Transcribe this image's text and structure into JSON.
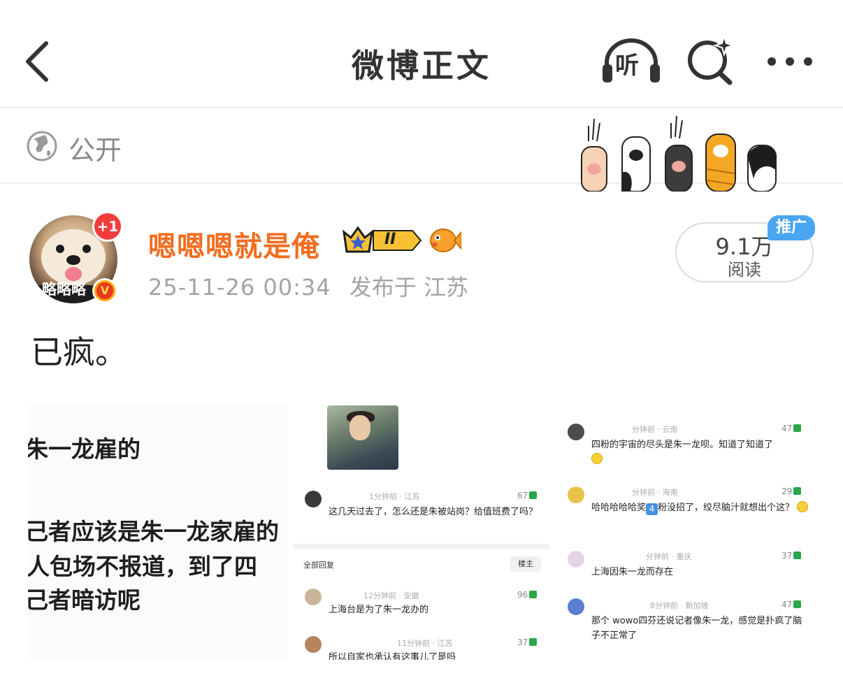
{
  "header": {
    "title": "微博正文",
    "listen_label": "听"
  },
  "visibility": {
    "label": "公开"
  },
  "author": {
    "name": "嗯嗯嗯就是俺",
    "avatar_tag": "略略略",
    "notification_badge": "+1",
    "verified_mark": "V",
    "badge_level": "II",
    "post_time": "25-11-26 00:34",
    "post_location": "发布于 江苏"
  },
  "stats": {
    "read_count": "9.1万",
    "read_label": "阅读",
    "promo_tag": "推广"
  },
  "post": {
    "text": "已疯。"
  },
  "embedded_image": {
    "left_panel_lines": [
      "朱一龙雇的",
      "己者应该是朱一龙家雇的",
      "人包场不报道，到了四",
      "己者暗访呢"
    ],
    "middle_panel": {
      "top_comment": {
        "meta": "1分钟前 · 江苏",
        "likes": "67",
        "text": "这几天过去了，怎么还是朱被站岗？给值班费了吗？"
      },
      "all_replies_label": "全部回复",
      "op_tag": "楼主",
      "replies": [
        {
          "meta": "12分钟前 · 安徽",
          "likes": "96",
          "text": "上海台是为了朱一龙办的"
        },
        {
          "meta": "11分钟前 · 江苏",
          "likes": "37",
          "text": "所以自家也承认有这事儿了是吗"
        }
      ]
    },
    "right_panel_comments": [
      {
        "meta": "分钟前 · 云南",
        "likes": "47",
        "text": "四粉的宇宙的尽头是朱一龙呗。知道了知道了"
      },
      {
        "meta": "分钟前 · 海南",
        "likes": "29",
        "text_a": "哈哈哈哈哈奖",
        "badge": "4",
        "text_b": "粉没招了，绞尽脑汁就想出个这？"
      },
      {
        "meta": "分钟前 · 重庆",
        "likes": "37",
        "text": "上海因朱一龙而存在"
      },
      {
        "meta": "8分钟前 · 新加坡",
        "likes": "47",
        "text": "那个 wowo四芬还说记者像朱一龙，感觉是扑疯了脑子不正常了"
      }
    ]
  },
  "colors": {
    "username": "#f26d1f",
    "promo": "#4aa6f2",
    "like_thumb": "#2aa64a",
    "notification": "#f23c3c"
  },
  "icons": [
    "back-arrow-icon",
    "listen-icon",
    "search-sparkle-icon",
    "more-icon",
    "globe-icon",
    "crown-badge-icon",
    "fish-badge-icon",
    "verified-icon",
    "paws-decoration"
  ]
}
